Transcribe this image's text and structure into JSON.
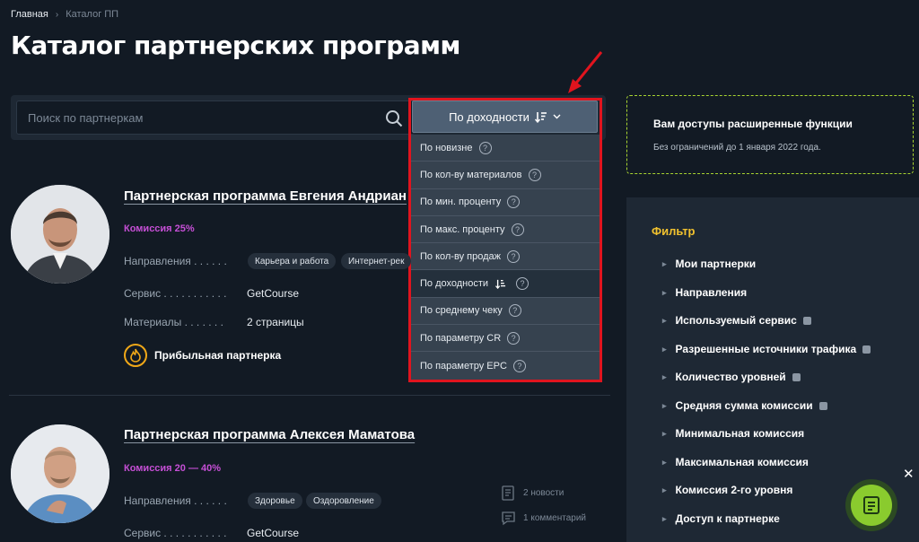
{
  "breadcrumb": {
    "home": "Главная",
    "separator": "›",
    "current": "Каталог ПП"
  },
  "page_title": "Каталог партнерских программ",
  "search": {
    "placeholder": "Поиск по партнеркам",
    "value": ""
  },
  "sort": {
    "selected_label": "По доходности",
    "options": [
      {
        "label": "По новизне",
        "help": "?"
      },
      {
        "label": "По кол-ву материалов",
        "help": "?"
      },
      {
        "label": "По мин. проценту",
        "help": "?"
      },
      {
        "label": "По макс. проценту",
        "help": "?"
      },
      {
        "label": "По кол-ву продаж",
        "help": "?"
      },
      {
        "label": "По доходности",
        "help": "?",
        "active": true
      },
      {
        "label": "По среднему чеку",
        "help": "?"
      },
      {
        "label": "По параметру CR",
        "help": "?"
      },
      {
        "label": "По параметру EPC",
        "help": "?"
      }
    ]
  },
  "cards": [
    {
      "title": "Партнерская программа Евгения Андриан",
      "commission": "Комиссия 25%",
      "directions_label": "Направления . . . . . .",
      "directions": [
        "Карьера и работа",
        "Интернет-рек"
      ],
      "service_label": "Сервис . . . . . . . . . . .",
      "service": "GetCourse",
      "materials_label": "Материалы . . . . . . .",
      "materials": "2 страницы",
      "badge": "Прибыльная партнерка"
    },
    {
      "title": "Партнерская программа Алексея Маматова",
      "commission": "Комиссия 20 — 40%",
      "directions_label": "Направления . . . . . .",
      "directions": [
        "Здоровье",
        "Оздоровление"
      ],
      "service_label": "Сервис . . . . . . . . . . .",
      "service": "GetCourse",
      "news": "2 новости",
      "comments": "1 комментарий"
    }
  ],
  "promo": {
    "title": "Вам доступы расширенные функции",
    "subtitle": "Без ограничений до 1 января 2022 года."
  },
  "filter": {
    "title": "Фильтр",
    "items": [
      {
        "label": "Мои партнерки",
        "info": false
      },
      {
        "label": "Направления",
        "info": false
      },
      {
        "label": "Используемый сервис",
        "info": true
      },
      {
        "label": "Разрешенные источники трафика",
        "info": true
      },
      {
        "label": "Количество уровней",
        "info": true
      },
      {
        "label": "Средняя сумма комиссии",
        "info": true
      },
      {
        "label": "Минимальная комиссия",
        "info": false
      },
      {
        "label": "Максимальная комиссия",
        "info": false
      },
      {
        "label": "Комиссия 2-го уровня",
        "info": false
      },
      {
        "label": "Доступ к партнерке",
        "info": false
      }
    ]
  },
  "close_label": "✕",
  "colors": {
    "accent_green": "#8acb2e",
    "highlight_red": "#e0141e",
    "filter_title": "#f2c22e",
    "commission": "#c64fd6"
  },
  "icons": {
    "search": "search-icon",
    "sort": "sort-desc-icon",
    "fire": "fire-icon",
    "fab": "notes-icon"
  }
}
